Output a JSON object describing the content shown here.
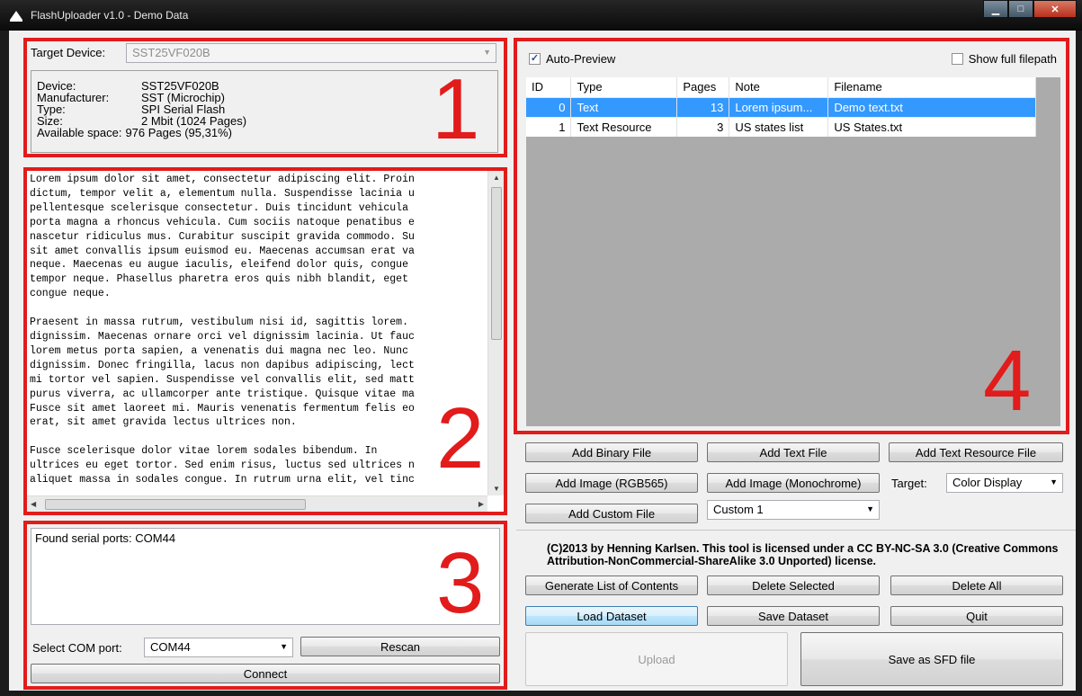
{
  "window": {
    "title": "FlashUploader v1.0 - Demo Data",
    "controls": [
      "minimize",
      "maximize",
      "close"
    ]
  },
  "callouts": [
    "1",
    "2",
    "3",
    "4"
  ],
  "device_panel": {
    "target_label": "Target Device:",
    "target_value": "SST25VF020B",
    "info": [
      {
        "key": "Device:",
        "value": "SST25VF020B"
      },
      {
        "key": "Manufacturer:",
        "value": "SST (Microchip)"
      },
      {
        "key": "Type:",
        "value": "SPI Serial Flash"
      },
      {
        "key": "Size:",
        "value": "2 Mbit (1024 Pages)"
      },
      {
        "key": "Available space:",
        "value": "976 Pages (95,31%)"
      }
    ]
  },
  "preview_text": "Lorem ipsum dolor sit amet, consectetur adipiscing elit. Proin\ndictum, tempor velit a, elementum nulla. Suspendisse lacinia u\npellentesque scelerisque consectetur. Duis tincidunt vehicula\nporta magna a rhoncus vehicula. Cum sociis natoque penatibus e\nnascetur ridiculus mus. Curabitur suscipit gravida commodo. Su\nsit amet convallis ipsum euismod eu. Maecenas accumsan erat va\nneque. Maecenas eu augue iaculis, eleifend dolor quis, congue\ntempor neque. Phasellus pharetra eros quis nibh blandit, eget\ncongue neque.\n\nPraesent in massa rutrum, vestibulum nisi id, sagittis lorem.\ndignissim. Maecenas ornare orci vel dignissim lacinia. Ut fauc\nlorem metus porta sapien, a venenatis dui magna nec leo. Nunc\ndignissim. Donec fringilla, lacus non dapibus adipiscing, lect\nmi tortor vel sapien. Suspendisse vel convallis elit, sed matt\npurus viverra, ac ullamcorper ante tristique. Quisque vitae ma\nFusce sit amet laoreet mi. Mauris venenatis fermentum felis eo\nerat, sit amet gravida lectus ultrices non.\n\nFusce scelerisque dolor vitae lorem sodales bibendum. In\nultrices eu eget tortor. Sed enim risus, luctus sed ultrices n\naliquet massa in sodales congue. In rutrum urna elit, vel tinc",
  "serial_panel": {
    "log": "Found serial ports: COM44",
    "select_label": "Select COM port:",
    "selected_port": "COM44",
    "rescan_label": "Rescan",
    "connect_label": "Connect"
  },
  "files_panel": {
    "auto_preview_label": "Auto-Preview",
    "auto_preview_checked": true,
    "show_full_path_label": "Show full filepath",
    "show_full_path_checked": false,
    "columns": [
      "ID",
      "Type",
      "Pages",
      "Note",
      "Filename"
    ],
    "rows": [
      {
        "id": "0",
        "type": "Text",
        "pages": "13",
        "note": "Lorem ipsum...",
        "filename": "Demo text.txt",
        "selected": true
      },
      {
        "id": "1",
        "type": "Text Resource",
        "pages": "3",
        "note": "US states list",
        "filename": "US States.txt",
        "selected": false
      }
    ]
  },
  "add_buttons": {
    "add_binary": "Add Binary File",
    "add_text": "Add Text File",
    "add_text_resource": "Add Text Resource File",
    "add_image_rgb": "Add Image (RGB565)",
    "add_image_mono": "Add Image (Monochrome)",
    "target_label": "Target:",
    "target_value": "Color Display",
    "add_custom": "Add Custom File",
    "custom_value": "Custom 1"
  },
  "copyright": "(C)2013 by Henning Karlsen. This tool is licensed under a CC BY-NC-SA 3.0 (Creative Commons Attribution-NonCommercial-ShareAlike 3.0 Unported) license.",
  "actions": {
    "generate_list": "Generate List of Contents",
    "delete_selected": "Delete Selected",
    "delete_all": "Delete All",
    "load_dataset": "Load Dataset",
    "save_dataset": "Save Dataset",
    "quit": "Quit",
    "upload": "Upload",
    "save_sfd": "Save as SFD file"
  },
  "colors": {
    "highlight_frame": "#e21b1b",
    "selection": "#3399ff"
  }
}
